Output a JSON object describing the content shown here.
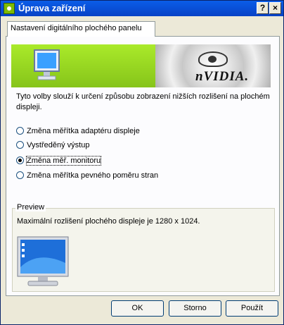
{
  "window": {
    "title": "Úprava zařízení",
    "help_label": "?",
    "close_label": "×"
  },
  "tab": {
    "label": "Nastavení digitálního plochého panelu"
  },
  "banner": {
    "brand": "nVIDIA."
  },
  "description": "Tyto volby slouží k určení způsobu zobrazení nižších rozlišení na plochém displeji.",
  "options": [
    {
      "label": "Změna měřítka adaptéru displeje",
      "selected": false
    },
    {
      "label": "Vystředěný výstup",
      "selected": false
    },
    {
      "label": "Změna měř. monitoru",
      "selected": true
    },
    {
      "label": "Změna měřítka pevného poměru stran",
      "selected": false
    }
  ],
  "preview": {
    "label": "Preview",
    "text": "Maximální rozlišení plochého displeje je 1280 x 1024."
  },
  "buttons": {
    "ok": "OK",
    "cancel": "Storno",
    "apply": "Použít"
  },
  "colors": {
    "titlebar": "#0842c6",
    "banner_green": "#86c41a"
  }
}
